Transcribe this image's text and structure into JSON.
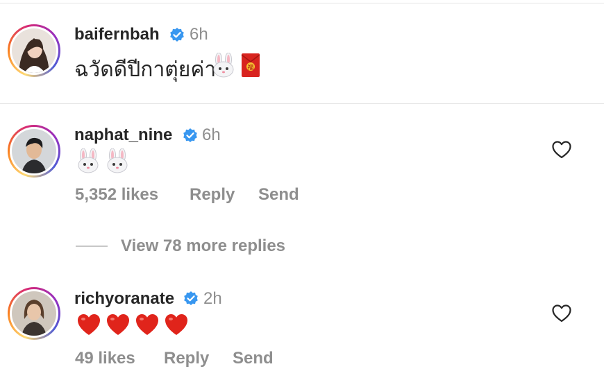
{
  "post": {
    "username": "baifernbah",
    "time": "6h",
    "caption": "ฉวัดดีปีกาตุ่ยค่า"
  },
  "comments": [
    {
      "username": "naphat_nine",
      "time": "6h",
      "likes": "5,352 likes",
      "reply": "Reply",
      "send": "Send"
    },
    {
      "username": "richyoranate",
      "time": "2h",
      "likes": "49 likes",
      "reply": "Reply",
      "send": "Send"
    }
  ],
  "view_more": "View 78 more replies",
  "colors": {
    "verified": "#3897f0",
    "heart": "#e0241b",
    "muted": "#8e8e8e",
    "text": "#262626"
  }
}
